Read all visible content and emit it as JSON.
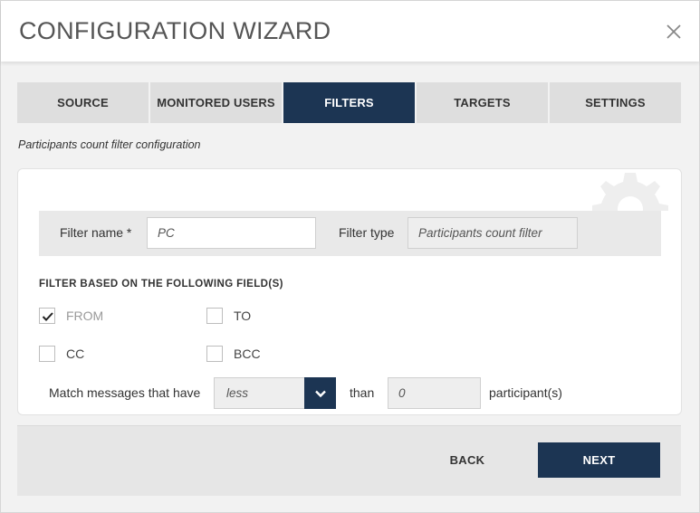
{
  "dialog": {
    "title": "CONFIGURATION WIZARD",
    "close_icon": "close-icon"
  },
  "tabs": [
    {
      "label": "SOURCE",
      "active": false
    },
    {
      "label": "MONITORED USERS",
      "active": false
    },
    {
      "label": "FILTERS",
      "active": true
    },
    {
      "label": "TARGETS",
      "active": false
    },
    {
      "label": "SETTINGS",
      "active": false
    }
  ],
  "section": {
    "caption": "Participants count filter configuration"
  },
  "filter": {
    "name_label": "Filter name *",
    "name_value": "PC",
    "type_label": "Filter type",
    "type_value": "Participants count filter"
  },
  "fields": {
    "heading": "FILTER BASED ON THE FOLLOWING FIELD(S)",
    "items": [
      {
        "label": "FROM",
        "checked": true
      },
      {
        "label": "TO",
        "checked": false
      },
      {
        "label": "CC",
        "checked": false
      },
      {
        "label": "BCC",
        "checked": false
      }
    ]
  },
  "match": {
    "prefix": "Match messages that have",
    "comparison": "less",
    "middle": "than",
    "count": "0",
    "suffix": "participant(s)"
  },
  "footer": {
    "back_label": "BACK",
    "next_label": "NEXT"
  },
  "colors": {
    "accent": "#1c3553",
    "tab_inactive": "#dedede",
    "background": "#f2f2f2"
  }
}
